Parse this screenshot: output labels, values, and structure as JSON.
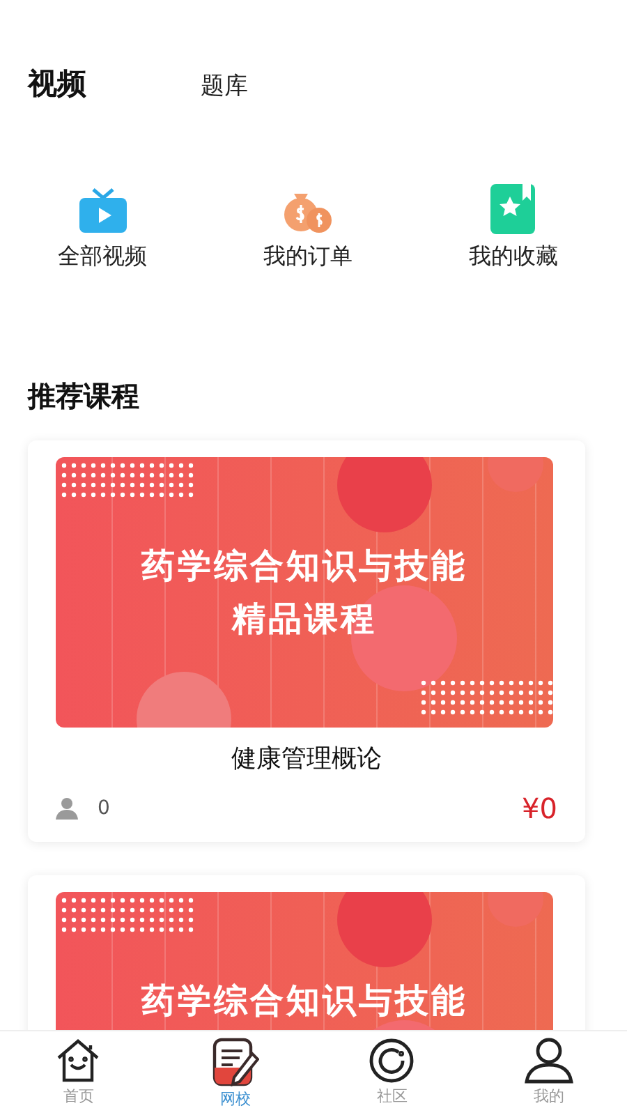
{
  "tabs": [
    {
      "label": "视频",
      "selected": true
    },
    {
      "label": "题库",
      "selected": false
    }
  ],
  "shortcuts": [
    {
      "kind": "tv",
      "label": "全部视频"
    },
    {
      "kind": "money",
      "label": "我的订单"
    },
    {
      "kind": "bookmark",
      "label": "我的收藏"
    }
  ],
  "section_title": "推荐课程",
  "courses": [
    {
      "cover": {
        "kind": "picture",
        "lines": [
          "药学综合知识与技能",
          "精品课程"
        ]
      },
      "title": "健康管理概论",
      "learners": "0",
      "price": "¥0"
    },
    {
      "cover": {
        "kind": "picture",
        "lines": [
          "药学综合知识与技能"
        ]
      }
    }
  ],
  "nav": [
    {
      "kind": "home",
      "label": "首页",
      "selected": false
    },
    {
      "kind": "school",
      "label": "网校",
      "selected": true
    },
    {
      "kind": "community",
      "label": "社区",
      "selected": false
    },
    {
      "kind": "profile",
      "label": "我的",
      "selected": false
    }
  ]
}
